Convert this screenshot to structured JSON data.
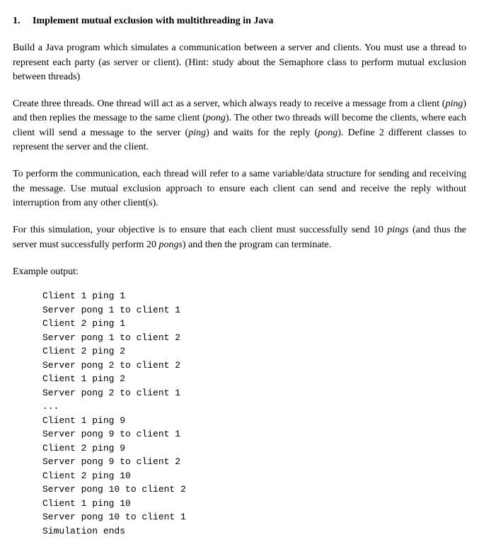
{
  "heading": {
    "number": "1.",
    "text": "Implement mutual exclusion with multithreading in Java"
  },
  "paragraphs": {
    "p1": "Build a Java program which simulates a communication between a server and clients. You must use a thread to represent each party (as server or client). (Hint: study about the Semaphore class to perform mutual exclusion between threads)",
    "p2_part1": "Create three threads. One thread will act as a server, which always ready to receive a message from a client (",
    "p2_em1": "ping",
    "p2_part2": ") and then replies the message to the same client (",
    "p2_em2": "pong",
    "p2_part3": "). The other two threads will become the clients, where each client will send a message to the server (",
    "p2_em3": "ping",
    "p2_part4": ") and waits for the reply (",
    "p2_em4": "pong",
    "p2_part5": "). Define 2 different classes to represent the server and the client.",
    "p3": "To perform the communication, each thread will refer to a same variable/data structure for sending and receiving the message. Use mutual exclusion approach to ensure each client can send and receive the reply without interruption from any other client(s).",
    "p4_part1": "For this simulation, your objective is to ensure that each client must successfully send 10 ",
    "p4_em1": "pings",
    "p4_part2": " (and thus the server must successfully perform 20 ",
    "p4_em2": "pongs",
    "p4_part3": ") and then the program can terminate."
  },
  "example_label": "Example output:",
  "example_output": "Client 1 ping 1\nServer pong 1 to client 1\nClient 2 ping 1\nServer pong 1 to client 2\nClient 2 ping 2\nServer pong 2 to client 2\nClient 1 ping 2\nServer pong 2 to client 1\n...\nClient 1 ping 9\nServer pong 9 to client 1\nClient 2 ping 9\nServer pong 9 to client 2\nClient 2 ping 10\nServer pong 10 to client 2\nClient 1 ping 10\nServer pong 10 to client 1\nSimulation ends"
}
